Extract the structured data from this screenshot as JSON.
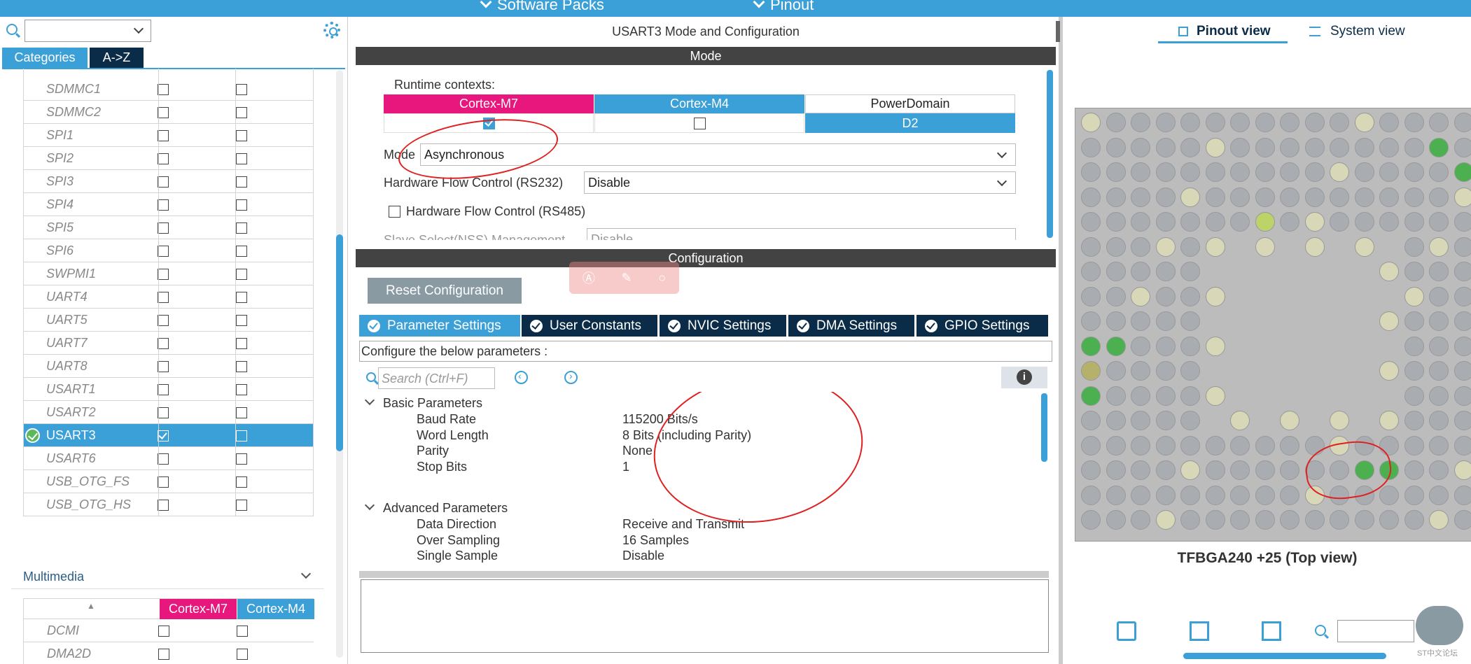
{
  "topbar": {
    "menu_software_packs": "Software Packs",
    "menu_pinout": "Pinout"
  },
  "left": {
    "tabs": {
      "categories": "Categories",
      "az": "A->Z"
    },
    "peripherals": [
      {
        "name": "SDMMC1",
        "selected": false
      },
      {
        "name": "SDMMC2",
        "selected": false
      },
      {
        "name": "SPI1",
        "selected": false
      },
      {
        "name": "SPI2",
        "selected": false
      },
      {
        "name": "SPI3",
        "selected": false
      },
      {
        "name": "SPI4",
        "selected": false
      },
      {
        "name": "SPI5",
        "selected": false
      },
      {
        "name": "SPI6",
        "selected": false
      },
      {
        "name": "SWPMI1",
        "selected": false
      },
      {
        "name": "UART4",
        "selected": false
      },
      {
        "name": "UART5",
        "selected": false
      },
      {
        "name": "UART7",
        "selected": false
      },
      {
        "name": "UART8",
        "selected": false
      },
      {
        "name": "USART1",
        "selected": false
      },
      {
        "name": "USART2",
        "selected": false
      },
      {
        "name": "USART3",
        "selected": true
      },
      {
        "name": "USART6",
        "selected": false
      },
      {
        "name": "USB_OTG_FS",
        "selected": false
      },
      {
        "name": "USB_OTG_HS",
        "selected": false
      }
    ],
    "multimedia": {
      "title": "Multimedia",
      "col1": "Cortex-M7",
      "col2": "Cortex-M4",
      "rows": [
        "DCMI",
        "DMA2D"
      ]
    }
  },
  "center": {
    "title": "USART3 Mode and Configuration",
    "mode_header": "Mode",
    "runtime_label": "Runtime contexts:",
    "ctx": {
      "m7": "Cortex-M7",
      "m4": "Cortex-M4",
      "pd": "PowerDomain",
      "d2": "D2"
    },
    "mode_label": "Mode",
    "mode_value": "Asynchronous",
    "hwfc232_label": "Hardware Flow Control (RS232)",
    "hwfc232_value": "Disable",
    "hwfc485_label": "Hardware Flow Control (RS485)",
    "nss_label": "Slave Select(NSS) Management",
    "nss_value": "Disable",
    "config_header": "Configuration",
    "reset_button": "Reset Configuration",
    "tabs": [
      "Parameter Settings",
      "User Constants",
      "NVIC Settings",
      "DMA Settings",
      "GPIO Settings"
    ],
    "configure_text": "Configure the below parameters :",
    "search_placeholder": "Search (Ctrl+F)",
    "basic_group": "Basic Parameters",
    "advanced_group": "Advanced Parameters",
    "basic_params": [
      {
        "name": "Baud Rate",
        "value": "115200 Bits/s"
      },
      {
        "name": "Word Length",
        "value": "8 Bits (including Parity)"
      },
      {
        "name": "Parity",
        "value": "None"
      },
      {
        "name": "Stop Bits",
        "value": "1"
      }
    ],
    "advanced_params": [
      {
        "name": "Data Direction",
        "value": "Receive and Transmit"
      },
      {
        "name": "Over Sampling",
        "value": "16 Samples"
      },
      {
        "name": "Single Sample",
        "value": "Disable"
      }
    ]
  },
  "right": {
    "pinout_view": "Pinout view",
    "system_view": "System view",
    "chip_label": "TFBGA240 +25 (Top view)",
    "watermark": "ST中文论坛"
  }
}
